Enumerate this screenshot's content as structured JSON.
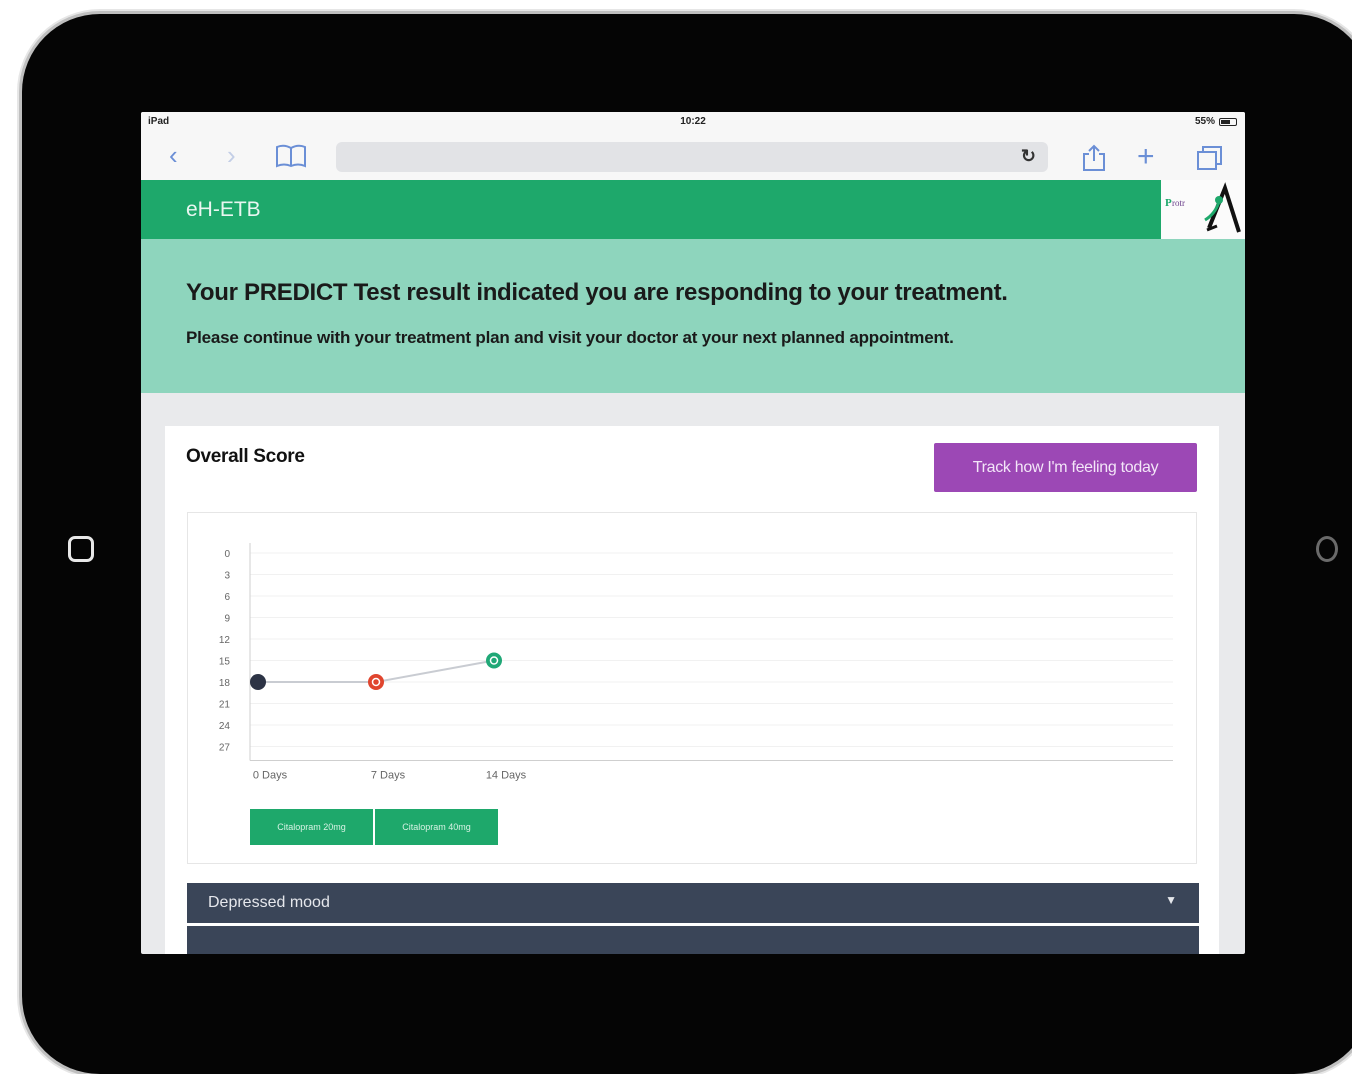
{
  "status_bar": {
    "device": "iPad",
    "time": "10:22",
    "battery": "55%"
  },
  "browser": {
    "url": ""
  },
  "app": {
    "title": "eH-ETB"
  },
  "banner": {
    "title": "Your PREDICT Test result indicated you are responding to your treatment.",
    "subtitle": "Please continue with your treatment plan and visit your doctor at your next planned appointment."
  },
  "card": {
    "title": "Overall Score",
    "track_button": "Track how I'm feeling today"
  },
  "chart_data": {
    "type": "line",
    "x": [
      "0 Days",
      "7 Days",
      "14 Days"
    ],
    "values": [
      18,
      18,
      15
    ],
    "y_ticks": [
      "0",
      "3",
      "6",
      "9",
      "12",
      "15",
      "18",
      "21",
      "24",
      "27"
    ],
    "ylim": [
      0,
      27
    ],
    "y_inverted": true,
    "point_colors": [
      "#2c3345",
      "#e0452e",
      "#20a877"
    ],
    "grid": true
  },
  "legend": [
    "Citalopram 20mg",
    "Citalopram 40mg"
  ],
  "accordion": [
    {
      "label": "Depressed mood"
    },
    {
      "label": ""
    }
  ],
  "colors": {
    "header_green": "#1ea86b",
    "banner_teal": "#8ed5bd",
    "track_purple": "#9c48b5",
    "accordion_navy": "#3a4558"
  }
}
